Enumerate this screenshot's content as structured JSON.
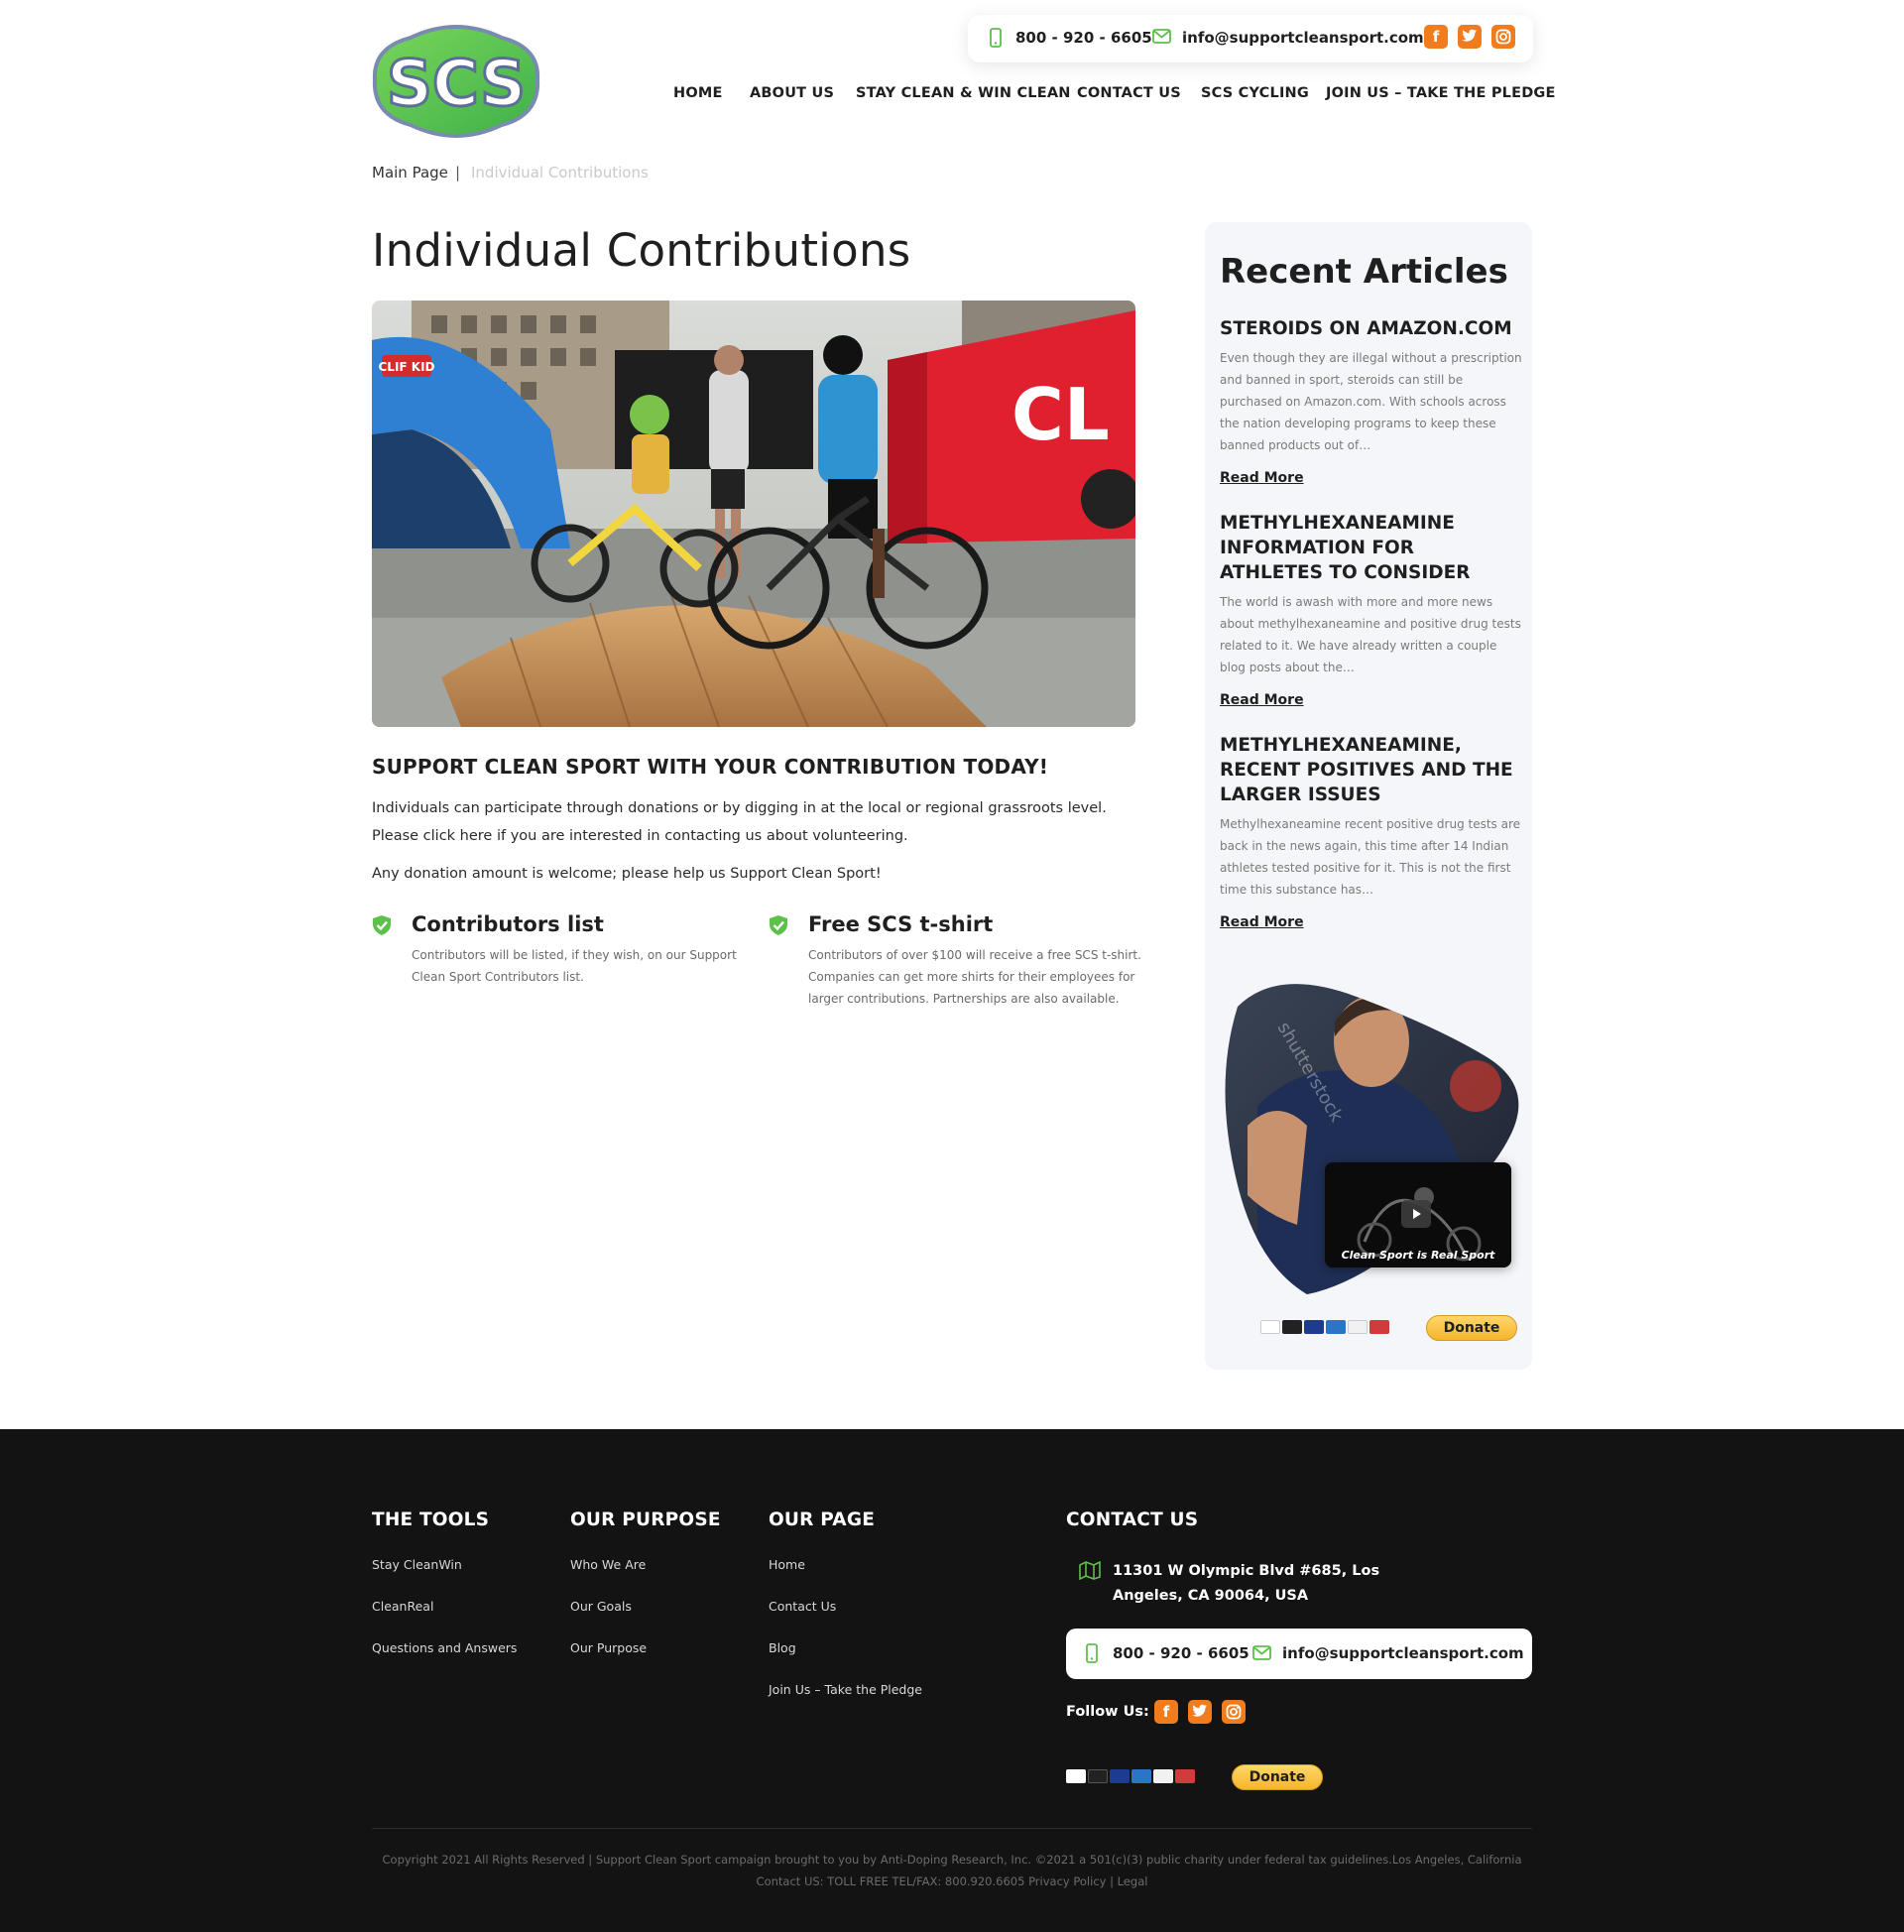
{
  "brand": {
    "logo_text": "SCS"
  },
  "topbar": {
    "phone": "800 - 920 - 6605",
    "email": "info@supportcleansport.com",
    "social": [
      {
        "icon": "facebook-icon"
      },
      {
        "icon": "twitter-icon"
      },
      {
        "icon": "instagram-icon"
      }
    ]
  },
  "nav": {
    "items": [
      {
        "label": "HOME"
      },
      {
        "label": "ABOUT US"
      },
      {
        "label": "STAY CLEAN & WIN CLEAN"
      },
      {
        "label": "CONTACT US"
      },
      {
        "label": "SCS CYCLING"
      },
      {
        "label": "JOIN US – TAKE THE PLEDGE"
      }
    ]
  },
  "breadcrumb": {
    "home": "Main Page",
    "separator": "|",
    "current": "Individual Contributions"
  },
  "main": {
    "title": "Individual Contributions",
    "hero_signs": {
      "tent": "CLIF KID",
      "trailer": "CL"
    },
    "section_title": "SUPPORT CLEAN SPORT WITH YOUR CONTRIBUTION TODAY!",
    "paragraph1": "Individuals can participate through donations or by digging in at the local or regional grassroots level. Please click here if you are interested in contacting us about volunteering.",
    "paragraph2": "Any donation amount is welcome; please help us Support Clean Sport!",
    "features": [
      {
        "title": "Contributors list",
        "text": "Contributors will be listed, if they wish, on our Support Clean Sport Contributors list."
      },
      {
        "title": "Free SCS t-shirt",
        "text": "Contributors of over $100 will receive a free SCS t-shirt. Companies can get more shirts for their employees for larger contributions. Partnerships are also available."
      }
    ]
  },
  "sidebar": {
    "title": "Recent Articles",
    "articles": [
      {
        "title": "STEROIDS ON AMAZON.COM",
        "excerpt": "Even though they are illegal without a prescription and banned in sport, steroids can still be purchased on Amazon.com. With schools across the nation developing programs to keep these banned products out of…",
        "more": "Read More"
      },
      {
        "title": "METHYLHEXANEAMINE INFORMATION FOR ATHLETES TO CONSIDER",
        "excerpt": "The world is awash with more and more news about methylhexaneamine and positive drug tests related to it.  We have already written a couple blog posts about the…",
        "more": "Read More"
      },
      {
        "title": "METHYLHEXANEAMINE, RECENT POSITIVES AND THE LARGER ISSUES",
        "excerpt": "Methylhexaneamine recent positive drug tests are back in the news again, this time after 14 Indian athletes tested positive for it. This is not the first time this substance has…",
        "more": "Read More"
      }
    ],
    "video_caption": "Clean Sport is Real Sport",
    "watermark": "shutterstock",
    "donate_label": "Donate"
  },
  "payment_cards": [
    "VISA",
    "MC",
    "Maestro",
    "AMEX",
    "DISCOVER",
    "UnionPay"
  ],
  "footer": {
    "columns": [
      {
        "heading": "THE TOOLS",
        "links": [
          "Stay CleanWin",
          "CleanReal",
          "Questions and Answers"
        ]
      },
      {
        "heading": "OUR PURPOSE",
        "links": [
          "Who We Are",
          "Our Goals",
          "Our Purpose"
        ]
      },
      {
        "heading": "OUR PAGE",
        "links": [
          "Home",
          "Contact Us",
          "Blog",
          "Join Us – Take the Pledge"
        ]
      }
    ],
    "contact_heading": "CONTACT US",
    "address": "11301 W Olympic Blvd #685, Los Angeles, CA 90064, USA",
    "phone": "800 - 920 - 6605",
    "email": "info@supportcleansport.com",
    "follow_label": "Follow Us:",
    "donate_label": "Donate",
    "copyright": "Copyright 2021 All Rights Reserved | Support Clean Sport campaign brought to you by Anti-Doping Research, Inc. ©2021 a 501(c)(3) public charity under federal tax guidelines.Los Angeles, California Contact US: TOLL FREE TEL/FAX: 800.920.6605 Privacy Policy | Legal"
  },
  "colors": {
    "accent_green": "#5cc04a",
    "social_orange": "#f07c1d",
    "footer_bg": "#131313",
    "sidebar_bg": "#f4f6fa",
    "donate_gold": "#f6b52c"
  }
}
